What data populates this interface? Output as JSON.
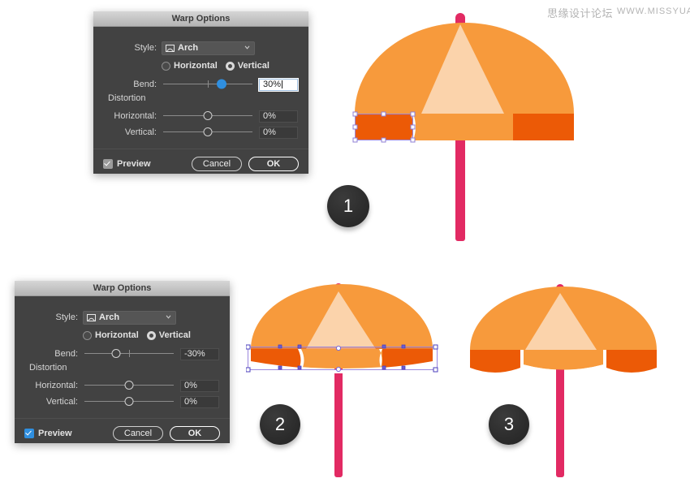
{
  "watermark": {
    "cn": "思缘设计论坛",
    "url": "WWW.MISSYUAN.COM"
  },
  "dialogs": [
    {
      "id": "warp-options-top",
      "title": "Warp Options",
      "active": false,
      "style": {
        "label": "Style:",
        "value": "Arch",
        "icon": "arch-icon"
      },
      "orientation": {
        "horizontal": {
          "label": "Horizontal",
          "selected": false
        },
        "vertical": {
          "label": "Vertical",
          "selected": true
        }
      },
      "bend": {
        "label": "Bend:",
        "value": "30%",
        "knob_percent": 65,
        "knob_style": "filled",
        "field_focused": true
      },
      "distortion": {
        "label": "Distortion",
        "horizontal": {
          "label": "Horizontal:",
          "value": "0%",
          "knob_percent": 50
        },
        "vertical": {
          "label": "Vertical:",
          "value": "0%",
          "knob_percent": 50
        }
      },
      "preview": {
        "label": "Preview",
        "checked": true,
        "accent": "gray"
      },
      "buttons": {
        "cancel": "Cancel",
        "ok": "OK"
      }
    },
    {
      "id": "warp-options-bottom",
      "title": "Warp Options",
      "active": true,
      "style": {
        "label": "Style:",
        "value": "Arch",
        "icon": "arch-icon"
      },
      "orientation": {
        "horizontal": {
          "label": "Horizontal",
          "selected": false
        },
        "vertical": {
          "label": "Vertical",
          "selected": true
        }
      },
      "bend": {
        "label": "Bend:",
        "value": "-30%",
        "knob_percent": 35,
        "knob_style": "hollow",
        "field_focused": false
      },
      "distortion": {
        "label": "Distortion",
        "horizontal": {
          "label": "Horizontal:",
          "value": "0%",
          "knob_percent": 50
        },
        "vertical": {
          "label": "Vertical:",
          "value": "0%",
          "knob_percent": 50
        }
      },
      "preview": {
        "label": "Preview",
        "checked": true,
        "accent": "blue"
      },
      "buttons": {
        "cancel": "Cancel",
        "ok": "OK"
      }
    }
  ],
  "steps": [
    {
      "number": "1",
      "caption": "umbrella-step-1"
    },
    {
      "number": "2",
      "caption": "umbrella-step-2"
    },
    {
      "number": "3",
      "caption": "umbrella-step-3"
    }
  ],
  "colors": {
    "dome_orange": "#f79a3c",
    "dome_light": "#fbd3ab",
    "band_light": "#f79a3c",
    "band_dark": "#ec5a06",
    "pole_pink": "#e22a63",
    "dialog_bg": "#424242",
    "dialog_title_bg": "#c8c8c8",
    "accent_blue": "#2f8fe0",
    "badge_dark": "#2c2c2c",
    "anchor_purple": "#8f7fd4",
    "canvas": "#ffffff"
  }
}
